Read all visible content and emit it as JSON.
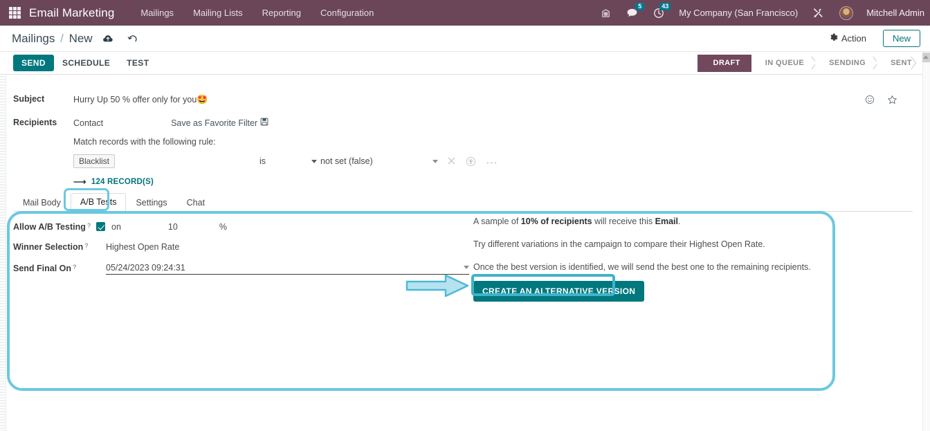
{
  "navbar": {
    "apps_icon": "apps-grid-icon",
    "brand": "Email Marketing",
    "menu": [
      {
        "label": "Mailings"
      },
      {
        "label": "Mailing Lists"
      },
      {
        "label": "Reporting"
      },
      {
        "label": "Configuration"
      }
    ],
    "icons": [
      {
        "name": "enterprise-icon",
        "glyph": "☷"
      },
      {
        "name": "messages-icon",
        "glyph": "💬",
        "badge": "5"
      },
      {
        "name": "activities-clock-icon",
        "glyph": "◔",
        "badge": "43"
      }
    ],
    "company": "My Company (San Francisco)",
    "tools_icon": "wrench-screwdriver-icon",
    "user": "Mitchell Admin"
  },
  "breadcrumb": {
    "root": "Mailings",
    "separator": "/",
    "current": "New",
    "save_icon": "cloud-upload-icon",
    "discard_icon": "undo-icon",
    "action_label": "Action",
    "action_icon": "gear-icon",
    "new_label": "New"
  },
  "statusbar": {
    "buttons": [
      {
        "label": "SEND",
        "primary": true
      },
      {
        "label": "SCHEDULE",
        "primary": false
      },
      {
        "label": "TEST",
        "primary": false
      }
    ],
    "stages": [
      {
        "label": "DRAFT",
        "active": true
      },
      {
        "label": "IN QUEUE",
        "active": false
      },
      {
        "label": "SENDING",
        "active": false
      },
      {
        "label": "SENT",
        "active": false
      }
    ]
  },
  "form": {
    "subject_label": "Subject",
    "subject_value": "Hurry Up 50 % offer only for you",
    "subject_emoji": "🤩",
    "emoji_icon": "smiley-icon",
    "favorite_icon": "star-icon",
    "recipients_label": "Recipients",
    "recipients_model": "Contact",
    "save_favorite_filter": "Save as Favorite Filter",
    "save_filter_icon": "floppy-disk-icon",
    "match_text": "Match records with the following rule:",
    "rule_field": "Blacklist",
    "rule_operator": "is",
    "rule_value": "not set (false)",
    "delete_icon": "close-x-icon",
    "add_icon": "circle-plus-icon",
    "more_icon": "ellipsis-icon",
    "records_count": "124 RECORD(S)",
    "records_arrow_icon": "arrow-right-icon"
  },
  "tabs": [
    {
      "label": "Mail Body",
      "active": false
    },
    {
      "label": "A/B Tests",
      "active": true
    },
    {
      "label": "Settings",
      "active": false
    },
    {
      "label": "Chat",
      "active": false
    }
  ],
  "ab_tests": {
    "allow_label": "Allow A/B Testing",
    "allow_checked": true,
    "allow_state_text": "on",
    "percent_value": "10",
    "percent_sign": "%",
    "winner_label": "Winner Selection",
    "winner_value": "Highest Open Rate",
    "send_final_label": "Send Final On",
    "send_final_value": "05/24/2023 09:24:31",
    "help_marker": "?",
    "note_1_a": "A sample of ",
    "note_1_b": "10% of recipients",
    "note_1_c": " will receive this ",
    "note_1_d": "Email",
    "note_1_e": ".",
    "note_2": "Try different variations in the campaign to compare their Highest Open Rate.",
    "note_3": "Once the best version is identified, we will send the best one to the remaining recipients.",
    "create_alt_label": "CREATE AN ALTERNATIVE VERSION"
  },
  "colors": {
    "navbar": "#6b4659",
    "primary_teal": "#00787d",
    "stage_active": "#71485c",
    "annotation_cyan": "#6cc8e0",
    "annotation_arrow": "#9fdaea"
  }
}
